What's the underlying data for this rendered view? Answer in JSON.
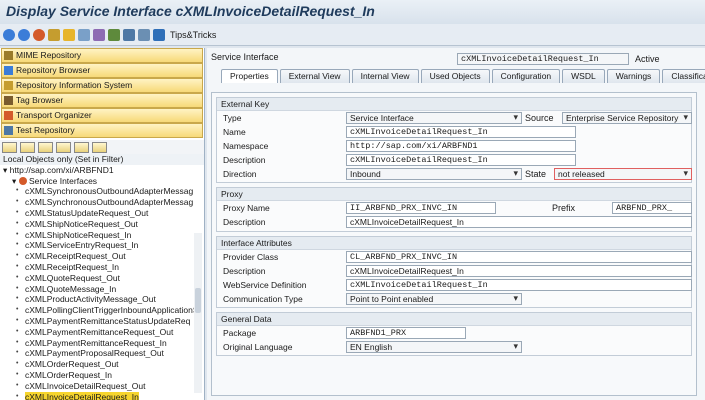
{
  "window": {
    "title": "Display Service Interface cXMLInvoiceDetailRequest_In"
  },
  "toolbar": {
    "tips_label": "Tips&Tricks",
    "icons": [
      "back-icon",
      "forward-icon",
      "other-object-icon",
      "display-change-icon",
      "activate-icon",
      "where-used-icon",
      "object-list-icon",
      "display-object-list-icon",
      "navigation-window-icon",
      "fullscreen-icon",
      "help-icon"
    ]
  },
  "nav": {
    "items": [
      {
        "label": "MIME Repository",
        "icon": "mime-icon"
      },
      {
        "label": "Repository Browser",
        "icon": "browser-icon"
      },
      {
        "label": "Repository Information System",
        "icon": "info-system-icon"
      },
      {
        "label": "Tag Browser",
        "icon": "tag-icon"
      },
      {
        "label": "Transport Organizer",
        "icon": "transport-icon"
      },
      {
        "label": "Test Repository",
        "icon": "test-icon"
      }
    ],
    "filter_text": "Local Objects only (Set in Filter)",
    "namespace": "http://sap.com/xi/ARBFND1",
    "folder": "Service Interfaces",
    "tree_items": [
      "cXMLSynchronousOutboundAdapterMessag",
      "cXMLSynchronousOutboundAdapterMessag",
      "cXMLStatusUpdateRequest_Out",
      "cXMLShipNoticeRequest_Out",
      "cXMLShipNoticeRequest_In",
      "cXMLServiceEntryRequest_In",
      "cXMLReceiptRequest_Out",
      "cXMLReceiptRequest_In",
      "cXMLQuoteRequest_Out",
      "cXMLQuoteMessage_In",
      "cXMLProductActivityMessage_Out",
      "cXMLPollingClientTriggerInboundApplicationS",
      "cXMLPaymentRemittanceStatusUpdateReq",
      "cXMLPaymentRemittanceRequest_Out",
      "cXMLPaymentRemittanceRequest_In",
      "cXMLPaymentProposalRequest_Out",
      "cXMLOrderRequest_Out",
      "cXMLOrderRequest_In",
      "cXMLInvoiceDetailRequest_Out",
      "cXMLInvoiceDetailRequest_In"
    ],
    "selected_index": 19
  },
  "header": {
    "label": "Service Interface",
    "value": "cXMLInvoiceDetailRequest_In",
    "status": "Active"
  },
  "tabs": [
    "Properties",
    "External View",
    "Internal View",
    "Used Objects",
    "Configuration",
    "WSDL",
    "Warnings",
    "Classifications"
  ],
  "active_tab": 0,
  "external_key": {
    "title": "External Key",
    "type_label": "Type",
    "type_value": "Service Interface",
    "source_label": "Source",
    "source_value": "Enterprise Service Repository",
    "name_label": "Name",
    "name_value": "cXMLInvoiceDetailRequest_In",
    "namespace_label": "Namespace",
    "namespace_value": "http://sap.com/xi/ARBFND1",
    "description_label": "Description",
    "description_value": "cXMLInvoiceDetailRequest_In",
    "direction_label": "Direction",
    "direction_value": "Inbound",
    "state_label": "State",
    "state_value": "not released"
  },
  "proxy": {
    "title": "Proxy",
    "proxy_name_label": "Proxy Name",
    "proxy_name_value": "II_ARBFND_PRX_INVC_IN",
    "prefix_label": "Prefix",
    "prefix_value": "ARBFND_PRX_",
    "description_label": "Description",
    "description_value": "cXMLInvoiceDetailRequest_In"
  },
  "interface_attributes": {
    "title": "Interface Attributes",
    "provider_label": "Provider Class",
    "provider_value": "CL_ARBFND_PRX_INVC_IN",
    "description_label": "Description",
    "description_value": "cXMLInvoiceDetailRequest_In",
    "webservice_label": "WebService Definition",
    "webservice_value": "cXMLInvoiceDetailRequest_In",
    "comm_label": "Communication Type",
    "comm_value": "Point to Point enabled"
  },
  "general_data": {
    "title": "General Data",
    "package_label": "Package",
    "package_value": "ARBFND1_PRX",
    "lang_label": "Original Language",
    "lang_value": "EN English"
  },
  "colors": {
    "accent": "#1f3b5c",
    "nav_bg": "#f7d978",
    "selection": "#f6d52e"
  }
}
